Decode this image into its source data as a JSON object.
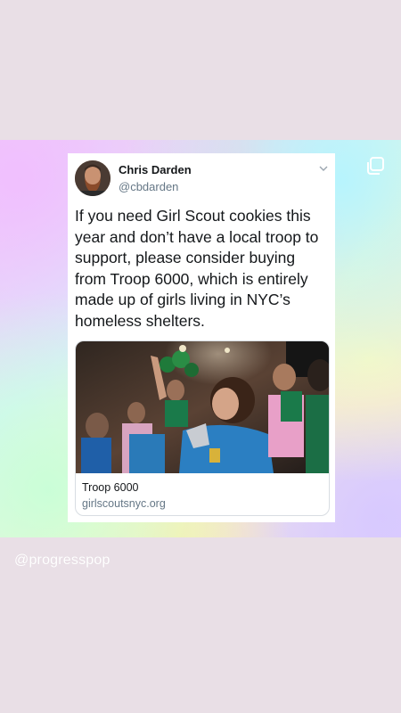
{
  "tweet": {
    "author_name": "Chris Darden",
    "author_handle": "@cbdarden",
    "text": "If you need Girl Scout cookies this year and don’t have a local troop to support, please consider buying from Troop 6000, which is entirely made up of girls living in NYC’s homeless shelters.",
    "icons": [
      "chevron-down-icon"
    ]
  },
  "link_card": {
    "title": "Troop 6000",
    "domain": "girlscoutsnyc.org"
  },
  "story": {
    "watermark": "@progresspop",
    "icons": [
      "copy-icon"
    ]
  }
}
